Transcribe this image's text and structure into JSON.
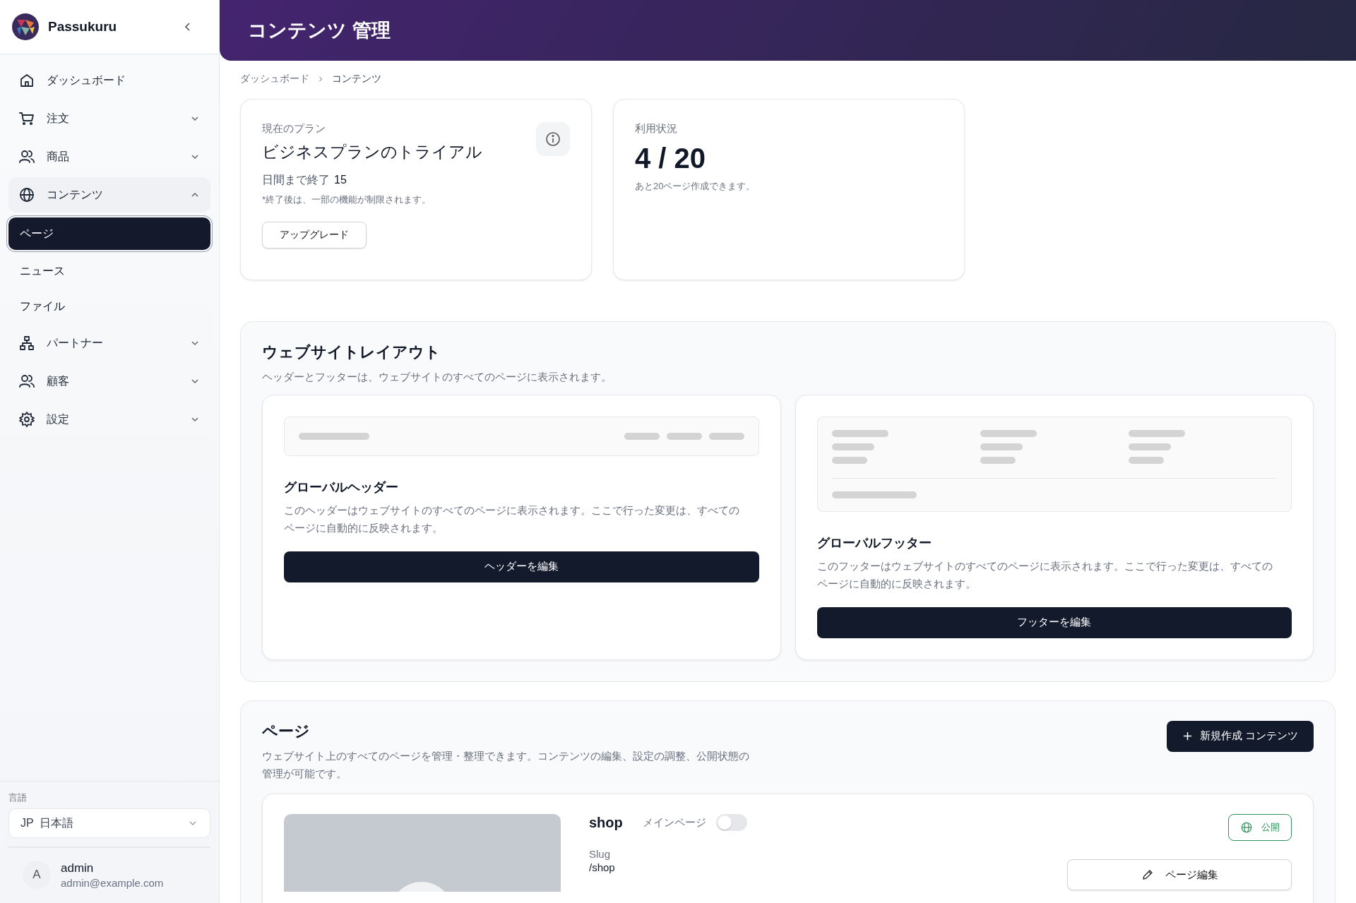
{
  "brand": {
    "name": "Passukuru"
  },
  "sidebar": {
    "items": [
      {
        "label": "ダッシュボード",
        "selected": false
      },
      {
        "label": "注文",
        "selected": false,
        "expanded": false
      },
      {
        "label": "商品",
        "selected": false,
        "expanded": false
      },
      {
        "label": "コンテンツ",
        "selected": false,
        "expanded": true,
        "children": [
          {
            "label": "ページ",
            "selected": true
          },
          {
            "label": "ニュース",
            "selected": false
          },
          {
            "label": "ファイル",
            "selected": false
          }
        ]
      },
      {
        "label": "パートナー",
        "selected": false,
        "expanded": false
      },
      {
        "label": "顧客",
        "selected": false,
        "expanded": false
      },
      {
        "label": "設定",
        "selected": false,
        "expanded": false
      }
    ],
    "language": {
      "label": "言語",
      "value": "JP  日本語"
    },
    "user": {
      "initial": "A",
      "name": "admin",
      "email": "admin@example.com"
    }
  },
  "header": {
    "title": "コンテンツ 管理"
  },
  "breadcrumb": [
    "ダッシュボード",
    "コンテンツ"
  ],
  "plan_card": {
    "label": "現在のプラン",
    "plan": "ビジネスプランのトライアル",
    "days_label": "日間まで終了",
    "days": "15",
    "note": "*終了後は、一部の機能が制限されます。",
    "button": "アップグレード"
  },
  "usage_card": {
    "label": "利用状況",
    "value": "4 / 20",
    "note": "あと20ページ作成できます。"
  },
  "layout_section": {
    "title": "ウェブサイトレイアウト",
    "description": "ヘッダーとフッターは、ウェブサイトのすべてのページに表示されます。",
    "cards": [
      {
        "kind": "header",
        "title": "グローバルヘッダー",
        "description": "このヘッダーはウェブサイトのすべてのページに表示されます。ここで行った変更は、すべてのページに自動的に反映されます。",
        "button": "ヘッダーを編集"
      },
      {
        "kind": "footer",
        "title": "グローバルフッター",
        "description": "このフッターはウェブサイトのすべてのページに表示されます。ここで行った変更は、すべてのページに自動的に反映されます。",
        "button": "フッターを編集"
      }
    ]
  },
  "pages_section": {
    "title": "ページ",
    "description": "ウェブサイト上のすべてのページを管理・整理できます。コンテンツの編集、設定の調整、公開状態の管理が可能です。",
    "new_button": "新規作成 コンテンツ",
    "pages": [
      {
        "name": "shop",
        "main_label": "メインページ",
        "main": false,
        "status": "公開",
        "color": "#2f8f5b",
        "slug_label": "Slug",
        "slug": "/shop",
        "edit_button": "ページ編集"
      }
    ]
  }
}
